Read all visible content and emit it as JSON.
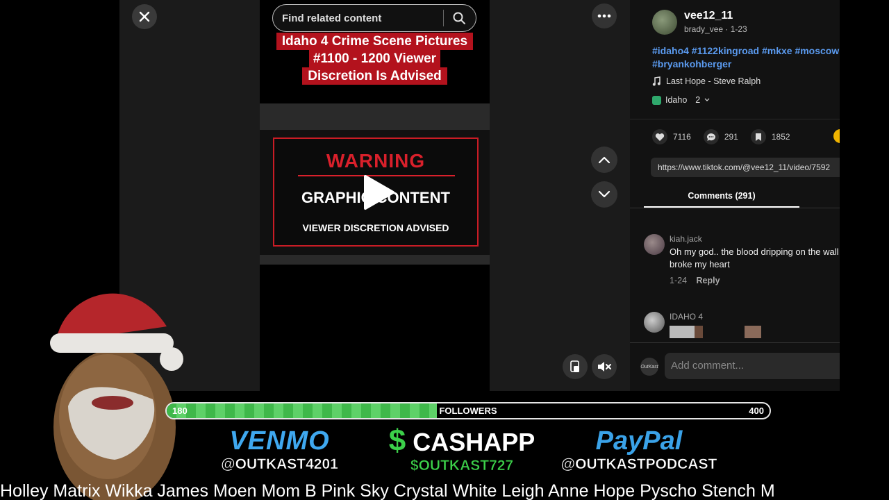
{
  "search": {
    "placeholder": "Find related content"
  },
  "caption": [
    "Idaho 4 Crime Scene Pictures",
    "#1100 - 1200 Viewer",
    "Discretion Is Advised"
  ],
  "warning": {
    "title": "WARNING",
    "graphic": "GRAPHIC CONTENT",
    "viewer": "VIEWER DISCRETION ADVISED"
  },
  "post": {
    "username": "vee12_11",
    "subline": "brady_vee · 1-23",
    "hashtags": "#idaho4 #1122kingroad #mkxe #moscow #bryankohberger",
    "music": "Last Hope - Steve Ralph",
    "location": "Idaho",
    "location_count": "2"
  },
  "stats": {
    "likes": "7116",
    "comments": "291",
    "saves": "1852"
  },
  "link": "https://www.tiktok.com/@vee12_11/video/7592",
  "tabs": {
    "comments": "Comments (291)"
  },
  "comments": [
    {
      "user": "kiah.jack",
      "text": "Oh my god.. the blood dripping on the wall broke my heart",
      "date": "1-24",
      "reply": "Reply"
    },
    {
      "user": "IDAHO 4"
    }
  ],
  "composer": {
    "placeholder": "Add comment...",
    "avatar_text": "OutKast"
  },
  "overlay": {
    "progress": {
      "min": "180",
      "label": "FOLLOWERS",
      "max": "400",
      "fraction": 0.448
    },
    "venmo": {
      "brand": "VENMO",
      "handle": "@OUTKAST4201"
    },
    "cashapp": {
      "brand": "CASHAPP",
      "dollar": "$",
      "handle": "$OUTKAST727"
    },
    "paypal": {
      "brand": "PayPal",
      "handle": "@OUTKASTPODCAST"
    },
    "ticker": "Holley Matrix Wikka James Moen Mom B  Pink Sky  Crystal White  Leigh Anne Hope Pyscho Stench M"
  },
  "colors": {
    "accent_red": "#b3121d",
    "warning_red": "#d9202b",
    "progress_green": "#3fb84a",
    "hashtag_blue": "#5b9bf0"
  }
}
